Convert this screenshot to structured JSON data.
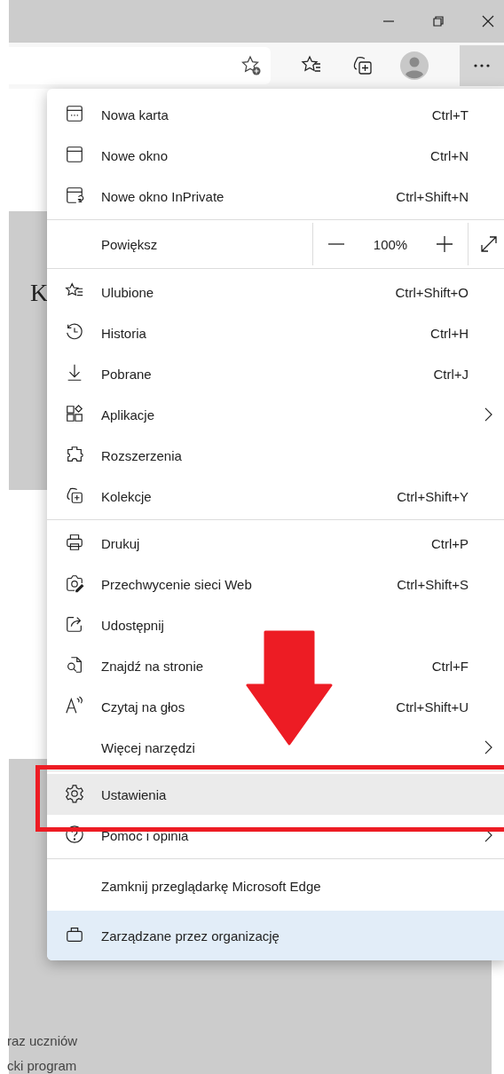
{
  "page": {
    "heading_letter": "K",
    "text_lines": [
      "raz uczniów",
      "cki program"
    ]
  },
  "menu": {
    "sections": [
      [
        {
          "kind": "item",
          "label": "Nowa karta",
          "shortcut": "Ctrl+T",
          "submenu": false,
          "highlighted": false
        },
        {
          "kind": "item",
          "label": "Nowe okno",
          "shortcut": "Ctrl+N",
          "submenu": false,
          "highlighted": false
        },
        {
          "kind": "item",
          "label": "Nowe okno InPrivate",
          "shortcut": "Ctrl+Shift+N",
          "submenu": false,
          "highlighted": false
        }
      ],
      [
        {
          "kind": "zoom",
          "label": "Powiększ",
          "value": "100%",
          "highlighted": false
        }
      ],
      [
        {
          "kind": "item",
          "label": "Ulubione",
          "shortcut": "Ctrl+Shift+O",
          "submenu": false,
          "highlighted": false
        },
        {
          "kind": "item",
          "label": "Historia",
          "shortcut": "Ctrl+H",
          "submenu": false,
          "highlighted": false
        },
        {
          "kind": "item",
          "label": "Pobrane",
          "shortcut": "Ctrl+J",
          "submenu": false,
          "highlighted": false
        },
        {
          "kind": "item",
          "label": "Aplikacje",
          "submenu": true,
          "highlighted": false
        },
        {
          "kind": "item",
          "label": "Rozszerzenia",
          "submenu": false,
          "highlighted": false
        },
        {
          "kind": "item",
          "label": "Kolekcje",
          "shortcut": "Ctrl+Shift+Y",
          "submenu": false,
          "highlighted": false
        }
      ],
      [
        {
          "kind": "item",
          "label": "Drukuj",
          "shortcut": "Ctrl+P",
          "submenu": false,
          "highlighted": false
        },
        {
          "kind": "item",
          "label": "Przechwycenie sieci Web",
          "shortcut": "Ctrl+Shift+S",
          "submenu": false,
          "highlighted": false
        },
        {
          "kind": "item",
          "label": "Udostępnij",
          "submenu": false,
          "highlighted": false
        },
        {
          "kind": "item",
          "label": "Znajdź na stronie",
          "shortcut": "Ctrl+F",
          "submenu": false,
          "highlighted": false
        },
        {
          "kind": "item",
          "label": "Czytaj na głos",
          "shortcut": "Ctrl+Shift+U",
          "submenu": false,
          "highlighted": false
        },
        {
          "kind": "item",
          "label": "Więcej narzędzi",
          "submenu": true,
          "highlighted": false
        }
      ],
      [
        {
          "kind": "item",
          "label": "Ustawienia",
          "submenu": false,
          "highlighted": true
        },
        {
          "kind": "item",
          "label": "Pomoc i opinia",
          "submenu": true,
          "highlighted": false
        }
      ],
      [
        {
          "kind": "item",
          "label": "Zamknij przeglądarkę Microsoft Edge",
          "submenu": false,
          "highlighted": false
        }
      ]
    ],
    "footer": {
      "label": "Zarządzane przez organizację"
    }
  }
}
